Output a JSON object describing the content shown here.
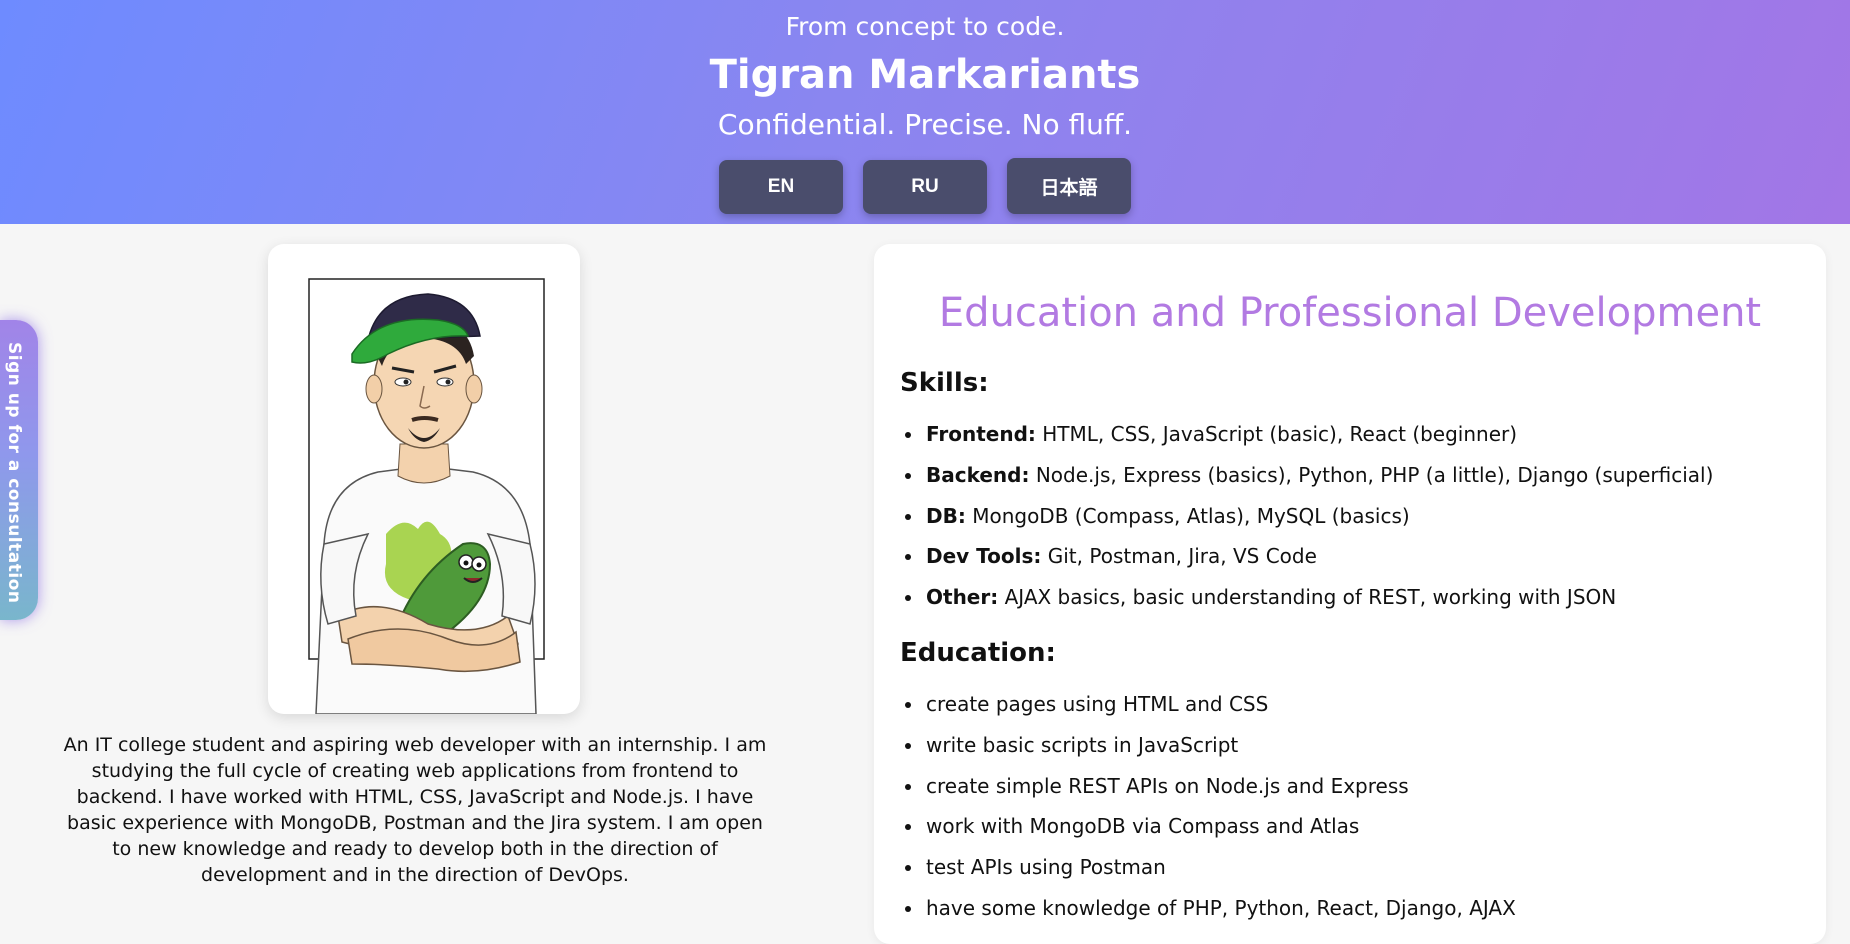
{
  "header": {
    "tagline": "From concept to code.",
    "name": "Tigran Markariants",
    "motto": "Confidential. Precise. No fluff.",
    "languages": [
      "EN",
      "RU",
      "日本語"
    ]
  },
  "side_tab": {
    "label": "Sign up for a consultation"
  },
  "bio": {
    "text": "An IT college student and aspiring web developer with an internship. I am studying the full cycle of creating web applications from frontend to backend. I have worked with HTML, CSS, JavaScript and Node.js. I have basic experience with MongoDB, Postman and the Jira system. I am open to new knowledge and ready to develop both in the direction of development and in the direction of DevOps."
  },
  "education_card": {
    "title": "Education and Professional Development",
    "skills_heading": "Skills:",
    "skills": [
      {
        "label": "Frontend:",
        "value": " HTML, CSS, JavaScript (basic), React (beginner)"
      },
      {
        "label": "Backend:",
        "value": " Node.js, Express (basics), Python, PHP (a little), Django (superficial)"
      },
      {
        "label": "DB:",
        "value": " MongoDB (Compass, Atlas), MySQL (basics)"
      },
      {
        "label": "Dev Tools:",
        "value": " Git, Postman, Jira, VS Code"
      },
      {
        "label": "Other:",
        "value": " AJAX basics, basic understanding of REST, working with JSON"
      }
    ],
    "education_heading": "Education:",
    "education": [
      "create pages using HTML and CSS",
      "write basic scripts in JavaScript",
      "create simple REST APIs on Node.js and Express",
      "work with MongoDB via Compass and Atlas",
      "test APIs using Postman",
      "have some knowledge of PHP, Python, React, Django, AJAX"
    ]
  },
  "colors": {
    "header_gradient_start": "#6e8bff",
    "header_gradient_end": "#a276e6",
    "lang_button": "#4a4d6c",
    "title_accent": "#b27ae2"
  }
}
